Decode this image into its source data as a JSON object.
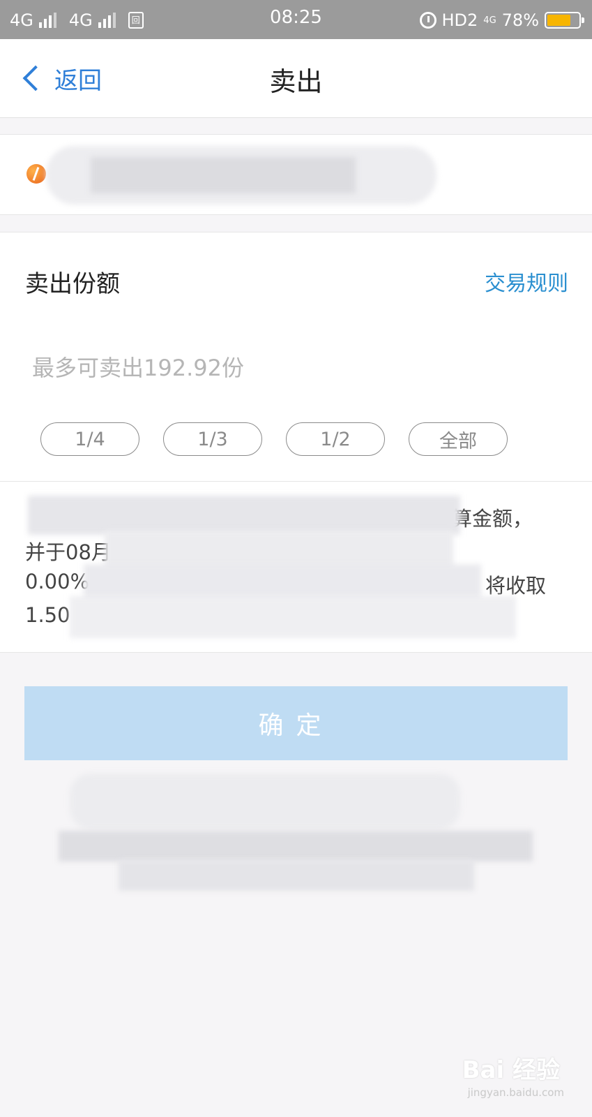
{
  "status_bar": {
    "network_1": "4G",
    "network_2": "4G",
    "sim_icon_text": "回",
    "time": "08:25",
    "hd_label": "HD2",
    "network_type": "4G",
    "battery_percent": "78%",
    "battery_level": 0.78,
    "battery_color": "#f7b500",
    "icons": [
      "signal-icon",
      "sim-icon",
      "alarm-icon",
      "battery-icon"
    ]
  },
  "header": {
    "back_label": "返回",
    "title": "卖出"
  },
  "sell": {
    "label": "卖出份额",
    "rules_link": "交易规则",
    "input_placeholder": "最多可卖出192.92份",
    "fractions": [
      "1/4",
      "1/3",
      "1/2",
      "全部"
    ]
  },
  "note": {
    "line1_tail": "算金额，",
    "line2_head": "并于08月",
    "line3_head": "0.00%",
    "line3_tail": "将收取",
    "line4_head": "1.50"
  },
  "confirm": {
    "label": "确定"
  },
  "colors": {
    "accent": "#2f7fd8",
    "link": "#2a8fd0",
    "confirm_disabled": "#bfdcf3"
  },
  "watermark": {
    "text": "Bai 经验",
    "sub": "jingyan.baidu.com"
  }
}
